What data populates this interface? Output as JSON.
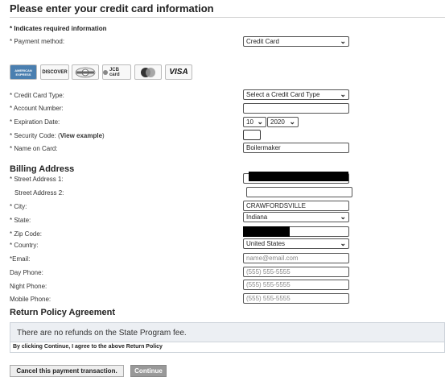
{
  "page_title": "Please enter your credit card information",
  "required_note": "* Indicates required information",
  "payment_method": {
    "label": "* Payment method:",
    "value": "Credit Card"
  },
  "card_logos": [
    "AMERICAN EXPRESS",
    "DISCOVER",
    "Diners Club",
    "JCB card",
    "MasterCard",
    "VISA"
  ],
  "card_type": {
    "label": "* Credit Card Type:",
    "value": "Select a Credit Card Type"
  },
  "account_number": {
    "label": "* Account Number:",
    "value": ""
  },
  "expiration": {
    "label": "* Expiration Date:",
    "month": "10",
    "year": "2020"
  },
  "security_code": {
    "label": "* Security Code: (",
    "link": "View example",
    "label_end": ")",
    "value": ""
  },
  "name_on_card": {
    "label": "* Name on Card:",
    "value": "Boilermaker"
  },
  "billing_title": "Billing Address",
  "street1": {
    "label": "* Street Address 1:"
  },
  "street2": {
    "label": "Street Address 2:",
    "value": ""
  },
  "city": {
    "label": "* City:",
    "value": "CRAWFORDSVILLE"
  },
  "state": {
    "label": "* State:",
    "value": "Indiana"
  },
  "zip": {
    "label": "* Zip Code:"
  },
  "country": {
    "label": "* Country:",
    "value": "United States"
  },
  "email": {
    "label": "*Email:",
    "placeholder": "name@email.com"
  },
  "day_phone": {
    "label": "Day Phone:",
    "placeholder": "(555) 555-5555"
  },
  "night_phone": {
    "label": "Night Phone:",
    "placeholder": "(555) 555-5555"
  },
  "mobile_phone": {
    "label": "Mobile Phone:",
    "placeholder": "(555) 555-5555"
  },
  "return_title": "Return Policy Agreement",
  "return_text": "There are no refunds on the State Program fee.",
  "agree_text": "By clicking Continue, I agree to the above Return Policy",
  "buttons": {
    "cancel": "Cancel this payment transaction.",
    "continue": "Continue"
  }
}
